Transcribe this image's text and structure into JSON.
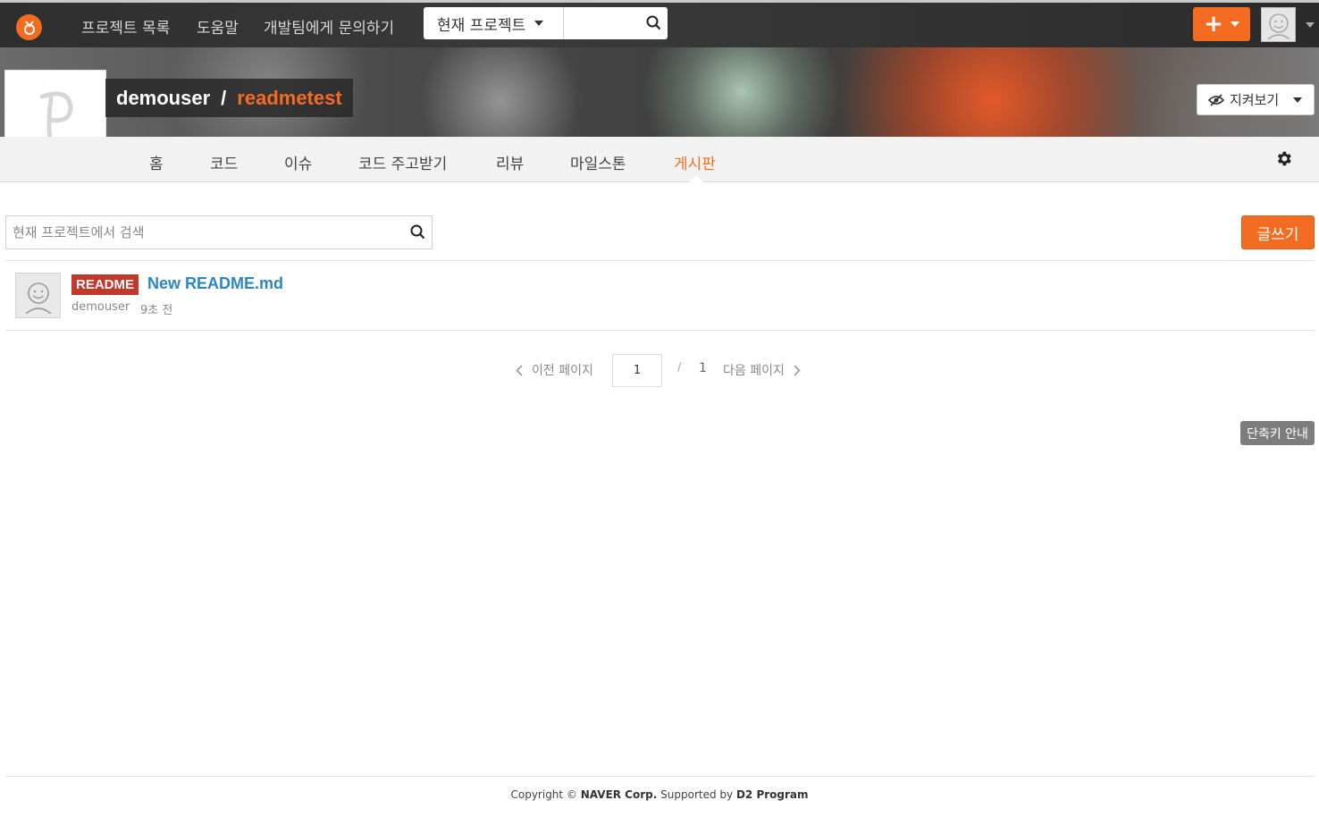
{
  "topnav": {
    "links": [
      "프로젝트 목록",
      "도움말",
      "개발팀에게 문의하기"
    ],
    "search_scope": "현재 프로젝트",
    "search_placeholder": ""
  },
  "project": {
    "owner": "demouser",
    "separator": "/",
    "name": "readmetest",
    "watch_label": "지켜보기"
  },
  "tabs": [
    "홈",
    "코드",
    "이슈",
    "코드 주고받기",
    "리뷰",
    "마일스톤",
    "게시판"
  ],
  "active_tab": "게시판",
  "board": {
    "search_placeholder": "현재 프로젝트에서 검색",
    "write_label": "글쓰기",
    "posts": [
      {
        "label": "README",
        "title": "New README.md",
        "author": "demouser",
        "time": "9초 전"
      }
    ]
  },
  "pagination": {
    "prev_label": "이전 페이지",
    "current": "1",
    "slash": "/",
    "total": "1",
    "next_label": "다음 페이지"
  },
  "shortcut_label": "단축키 안내",
  "footer": {
    "copyright": "Copyright ©",
    "company": "NAVER Corp.",
    "supported": "Supported by",
    "program": "D2 Program"
  },
  "colors": {
    "accent": "#f36c21",
    "label_red": "#c0392b",
    "link_blue": "#2e86c1"
  }
}
